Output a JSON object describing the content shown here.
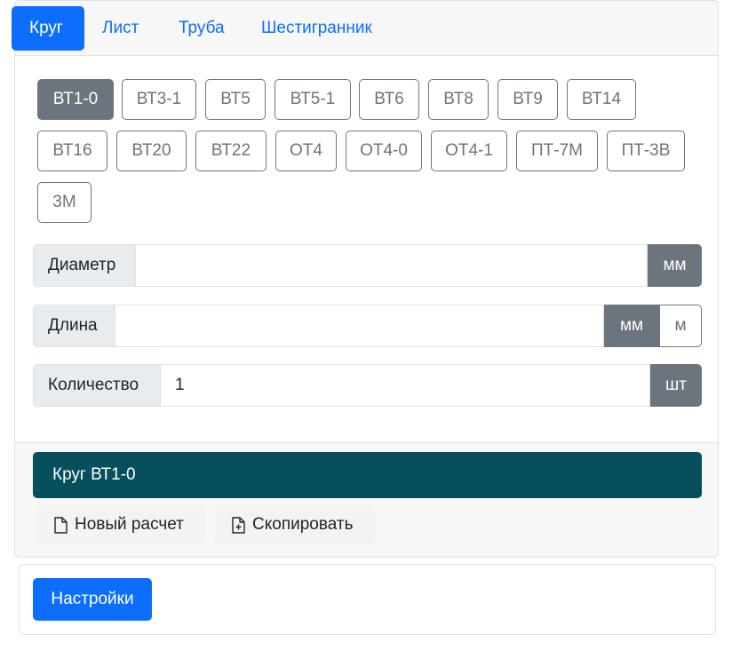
{
  "tabs": [
    {
      "label": "Круг",
      "active": true
    },
    {
      "label": "Лист",
      "active": false
    },
    {
      "label": "Труба",
      "active": false
    },
    {
      "label": "Шестигранник",
      "active": false
    }
  ],
  "alloys": [
    "ВТ1-0",
    "ВТ3-1",
    "ВТ5",
    "ВТ5-1",
    "ВТ6",
    "ВТ8",
    "ВТ9",
    "ВТ14",
    "ВТ16",
    "ВТ20",
    "ВТ22",
    "ОТ4",
    "ОТ4-0",
    "ОТ4-1",
    "ПТ-7М",
    "ПТ-3В",
    "3М"
  ],
  "selected_alloy": "ВТ1-0",
  "fields": {
    "diameter": {
      "label": "Диаметр",
      "value": "",
      "unit": "мм"
    },
    "length": {
      "label": "Длина",
      "value": "",
      "units": [
        "мм",
        "м"
      ],
      "selected_unit": "мм"
    },
    "quantity": {
      "label": "Количество",
      "value": "1",
      "unit": "шт"
    }
  },
  "result": {
    "title": "Круг ВТ1-0"
  },
  "actions": {
    "new_calc": "Новый расчет",
    "copy": "Скопировать"
  },
  "settings": {
    "label": "Настройки"
  },
  "colors": {
    "primary": "#0d6efd",
    "secondary": "#6c757d",
    "result_bg": "#05505c"
  },
  "icons": {
    "new_calc": "file-icon",
    "copy": "file-plus-icon"
  }
}
